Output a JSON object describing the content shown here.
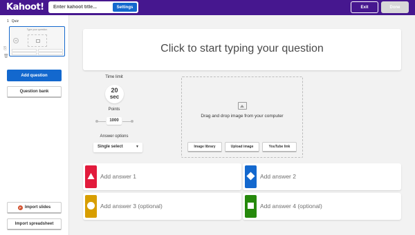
{
  "header": {
    "logo": "Kahoot!",
    "title_placeholder": "Enter kahoot title...",
    "settings_label": "Settings",
    "exit_label": "Exit",
    "done_label": "Done"
  },
  "sidebar": {
    "slide_number": "1",
    "slide_type": "Quiz",
    "thumb_question": "Type your question",
    "add_question_label": "Add question",
    "question_bank_label": "Question bank",
    "import_slides_label": "Import slides",
    "import_spreadsheet_label": "Import spreadsheet"
  },
  "question": {
    "placeholder": "Click to start typing your question"
  },
  "settings": {
    "time_limit_label": "Time limit",
    "time_value": "20",
    "time_unit": "sec",
    "points_label": "Points",
    "points_value": "1000",
    "answer_options_label": "Answer options",
    "answer_options_value": "Single select"
  },
  "media": {
    "drop_text": "Drag and drop image from your computer",
    "image_library_label": "Image library",
    "upload_image_label": "Upload image",
    "youtube_link_label": "YouTube link"
  },
  "answers": [
    {
      "label": "Add answer 1",
      "color": "#e21b3c",
      "shape": "triangle"
    },
    {
      "label": "Add answer 2",
      "color": "#1368ce",
      "shape": "diamond"
    },
    {
      "label": "Add answer 3 (optional)",
      "color": "#d89e00",
      "shape": "circle"
    },
    {
      "label": "Add answer 4 (optional)",
      "color": "#26890c",
      "shape": "square"
    }
  ],
  "colors": {
    "brand": "#46178f",
    "primary": "#1368ce"
  }
}
